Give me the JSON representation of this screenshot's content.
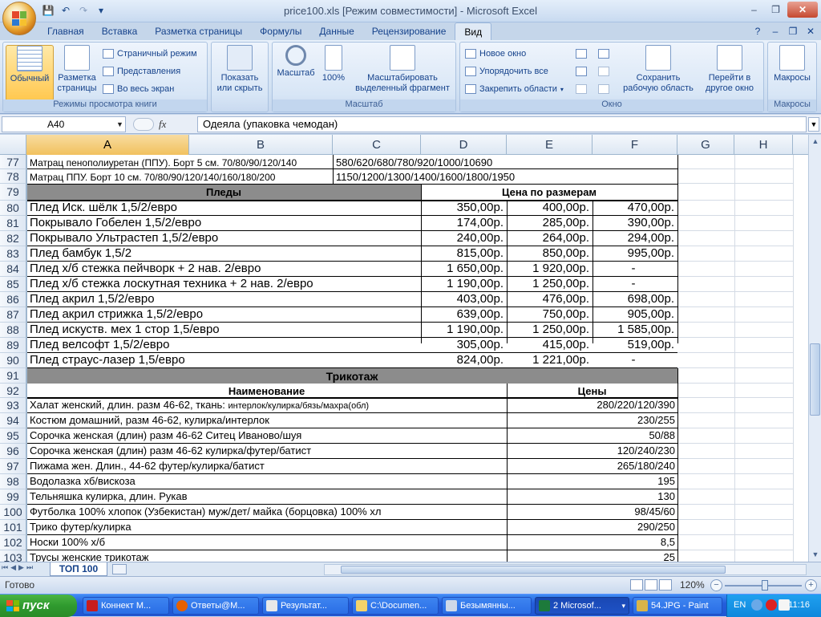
{
  "titlebar": {
    "title": "price100.xls  [Режим совместимости] - Microsoft Excel",
    "qat": {
      "save_icon": "💾",
      "undo_icon": "↶",
      "redo_icon": "↷",
      "customize_icon": "▾"
    },
    "controls": {
      "minimize": "–",
      "maximize": "❐",
      "close": "✕"
    }
  },
  "ribbon_tabs": [
    "Главная",
    "Вставка",
    "Разметка страницы",
    "Формулы",
    "Данные",
    "Рецензирование",
    "Вид"
  ],
  "ribbon_tab_icons": {
    "help": "?",
    "minimize": "–",
    "restore": "❐",
    "close": "✕"
  },
  "ribbon": {
    "views": {
      "label": "Режимы просмотра книги",
      "normal": "Обычный",
      "page_layout_1": "Разметка",
      "page_layout_2": "страницы",
      "page_break": "Страничный режим",
      "custom_views": "Представления",
      "full_screen": "Во весь экран"
    },
    "show": {
      "label_1": "Показать",
      "label_2": "или скрыть"
    },
    "zoom": {
      "label": "Масштаб",
      "zoom_btn": "Масштаб",
      "zoom100": "100%",
      "fit_1": "Масштабировать",
      "fit_2": "выделенный фрагмент"
    },
    "window": {
      "label": "Окно",
      "new_window": "Новое окно",
      "arrange_all": "Упорядочить все",
      "freeze": "Закрепить области",
      "save_ws_1": "Сохранить",
      "save_ws_2": "рабочую область",
      "switch_1": "Перейти в",
      "switch_2": "другое окно"
    },
    "macros": {
      "label": "Макросы",
      "btn": "Макросы"
    }
  },
  "formula_bar": {
    "name_box": "A40",
    "fx": "fx",
    "formula": "Одеяла (упаковка чемодан)"
  },
  "columns": [
    "A",
    "B",
    "C",
    "D",
    "E",
    "F",
    "G",
    "H"
  ],
  "rows": {
    "r77": {
      "num": "77",
      "a": "Матрац пенополиуретан (ППУ). Борт 5 см. 70/80/90/120/140",
      "c": "580/620/680/780/920/1000/10690"
    },
    "r78": {
      "num": "78",
      "a": "Матрац ППУ. Борт 10 см. 70/80/90/120/140/160/180/200",
      "c": "1150/1200/1300/1400/1600/1800/1950"
    },
    "r79": {
      "num": "79",
      "title": "Пледы",
      "price_title": "Цена по размерам"
    },
    "plaid": [
      {
        "num": "80",
        "name": "Плед Иск. шёлк 1,5/2/евро",
        "d": "350,00р.",
        "e": "400,00р.",
        "f": "470,00р."
      },
      {
        "num": "81",
        "name": "Покрывало Гобелен  1,5/2/евро",
        "d": "174,00р.",
        "e": "285,00р.",
        "f": "390,00р."
      },
      {
        "num": "82",
        "name": "Покрывало Ультрастеп  1,5/2/евро",
        "d": "240,00р.",
        "e": "264,00р.",
        "f": "294,00р."
      },
      {
        "num": "83",
        "name": "Плед бамбук 1,5/2",
        "d": "815,00р.",
        "e": "850,00р.",
        "f": "995,00р."
      },
      {
        "num": "84",
        "name": "Плед х/б стежка пейчворк + 2 нав. 2/евро",
        "d": "1 650,00р.",
        "e": "1 920,00р.",
        "f": "-"
      },
      {
        "num": "85",
        "name": "Плед х/б стежка лоскутная техника + 2 нав. 2/евро",
        "d": "1 190,00р.",
        "e": "1 250,00р.",
        "f": "-"
      },
      {
        "num": "86",
        "name": "Плед акрил 1,5/2/евро",
        "d": "403,00р.",
        "e": "476,00р.",
        "f": "698,00р."
      },
      {
        "num": "87",
        "name": "Плед акрил стрижка 1,5/2/евро",
        "d": "639,00р.",
        "e": "750,00р.",
        "f": "905,00р."
      },
      {
        "num": "88",
        "name": "Плед искуств. мех 1 стор 1,5/евро",
        "d": "1 190,00р.",
        "e": "1 250,00р.",
        "f": "1 585,00р."
      },
      {
        "num": "89",
        "name": "Плед велсофт  1,5/2/евро",
        "d": "305,00р.",
        "e": "415,00р.",
        "f": "519,00р."
      },
      {
        "num": "90",
        "name": "Плед страус-лазер  1,5/евро",
        "d": "824,00р.",
        "e": "1 221,00р.",
        "f": "-"
      }
    ],
    "r91": {
      "num": "91",
      "title": "Трикотаж"
    },
    "r92": {
      "num": "92",
      "name_hdr": "Наименование",
      "price_hdr": "Цены"
    },
    "knit": [
      {
        "num": "93",
        "name": "Халат женский, длин. разм 46-62, ткань: ",
        "name_small": "интерлок/кулирка/бязь/махра(обл)",
        "price": "280/220/120/390"
      },
      {
        "num": "94",
        "name": "Костюм домашний, разм 46-62, кулирка/интерлок",
        "price": "230/255"
      },
      {
        "num": "95",
        "name": "Сорочка женская (длин) разм 46-62 Ситец Иваново/шуя",
        "price": "50/88"
      },
      {
        "num": "96",
        "name": "Сорочка женская (длин) разм 46-62 кулирка/футер/батист",
        "price": "120/240/230"
      },
      {
        "num": "97",
        "name": "Пижама жен. Длин., 44-62 футер/кулирка/батист",
        "price": "265/180/240"
      },
      {
        "num": "98",
        "name": "Водолазка хб/вискоза",
        "price": "195"
      },
      {
        "num": "99",
        "name": "Тельняшка кулирка, длин. Рукав",
        "price": "130"
      },
      {
        "num": "100",
        "name": "Футболка 100% хлопок (Узбекистан) муж/дет/ майка (борцовка) 100% хл",
        "price": "98/45/60"
      },
      {
        "num": "101",
        "name": "Трико футер/кулирка",
        "price": "290/250"
      },
      {
        "num": "102",
        "name": "Носки 100% х/б",
        "price": "8,5"
      },
      {
        "num": "103",
        "name": "Трусы женские трикотаж",
        "price": "25"
      }
    ]
  },
  "sheet_tab": "ТОП 100",
  "status": {
    "ready": "Готово",
    "zoom": "120%"
  },
  "taskbar": {
    "start": "пуск",
    "tasks": [
      "Коннект М...",
      "Ответы@М...",
      "Результат...",
      "C:\\Documen...",
      "Безымянны...",
      "2 Microsof...",
      "54.JPG - Paint"
    ],
    "lang": "EN",
    "time": "11:16"
  },
  "colors": {
    "accent": "#15428b",
    "header_band": "#8c8c8c",
    "taskbar": "#245edb",
    "start": "#2f9a2e"
  }
}
